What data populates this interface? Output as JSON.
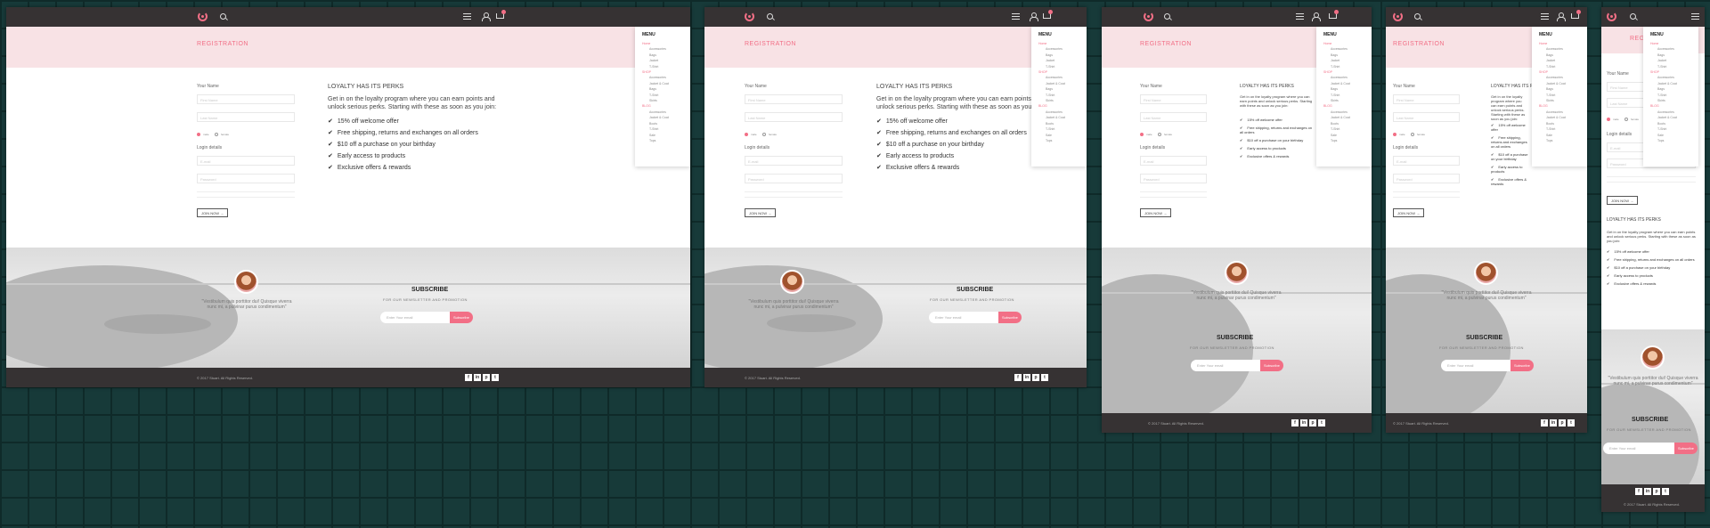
{
  "accent_color": "#f26f86",
  "page_title": "REGISTRATION",
  "form": {
    "name_label": "Your Name",
    "first_name_placeholder": "First Name",
    "last_name_placeholder": "Last Name",
    "gender_male": "male",
    "gender_female": "female",
    "login_label": "Login details",
    "email_placeholder": "E-mail",
    "password_placeholder": "Password",
    "join_label": "JOIN NOW"
  },
  "perks": {
    "title": "LOYALTY HAS ITS PERKS",
    "intro": "Get in on the loyalty program where you can earn points and unlock serious perks. Starting with these as soon as you join:",
    "items": [
      "15% off welcome offer",
      "Free shipping, returns and exchanges on all orders",
      "$10 off a purchase on your birthday",
      "Early access to products",
      "Exclusive offers & rewards"
    ]
  },
  "menu": {
    "title": "MENU",
    "items": [
      "Home",
      "Accessories",
      "Bags",
      "Jacket",
      "T-Shirt",
      "SHOP",
      "Accessories",
      "Jacket & Coat",
      "Bags",
      "T-Shirt",
      "Skirts",
      "BLOG",
      "Accessories",
      "Jacket & Coat",
      "Boots",
      "T-Shirt",
      "Sale",
      "Tops"
    ]
  },
  "testimonial": {
    "quote": "\"Vestibulum quis porttitor dui! Quisque viverra nunc mi, a pulvinar purus condimentum\""
  },
  "subscribe": {
    "title": "SUBSCRIBE",
    "subtitle": "FOR OUR NEWSLETTER AND PROMOTION",
    "email_placeholder": "Enter Your email",
    "button": "Subscribe"
  },
  "footer": {
    "copyright": "© 2017 Stuart. All Rights Reserved.",
    "social": [
      "f",
      "in",
      "p",
      "t"
    ]
  }
}
